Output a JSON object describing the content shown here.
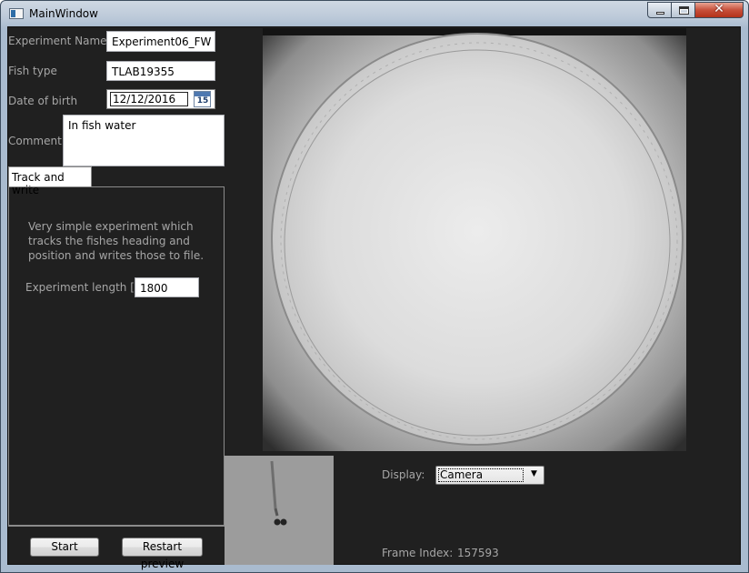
{
  "window": {
    "title": "MainWindow",
    "close_glyph": "✕"
  },
  "form": {
    "experiment_name_label": "Experiment Name",
    "experiment_name_value": "Experiment06_FW",
    "fish_type_label": "Fish type",
    "fish_type_value": "TLAB19355",
    "dob_label": "Date of birth",
    "dob_value": "12/12/2016",
    "calendar_day": "15",
    "comment_label": "Comment",
    "comment_value": "In fish water"
  },
  "tab": {
    "label": "Track and write",
    "description": "Very simple experiment which tracks the fishes heading and position and writes those to file.",
    "length_label": "Experiment length [s]",
    "length_value": "1800"
  },
  "buttons": {
    "start": "Start",
    "restart_preview": "Restart preview"
  },
  "display": {
    "label": "Display:",
    "selected": "Camera",
    "arrow": "▼"
  },
  "frame": {
    "label": "Frame Index:",
    "value": "157593"
  },
  "colors": {
    "panel_background": "#202020",
    "label_text": "#a6a6a6"
  }
}
